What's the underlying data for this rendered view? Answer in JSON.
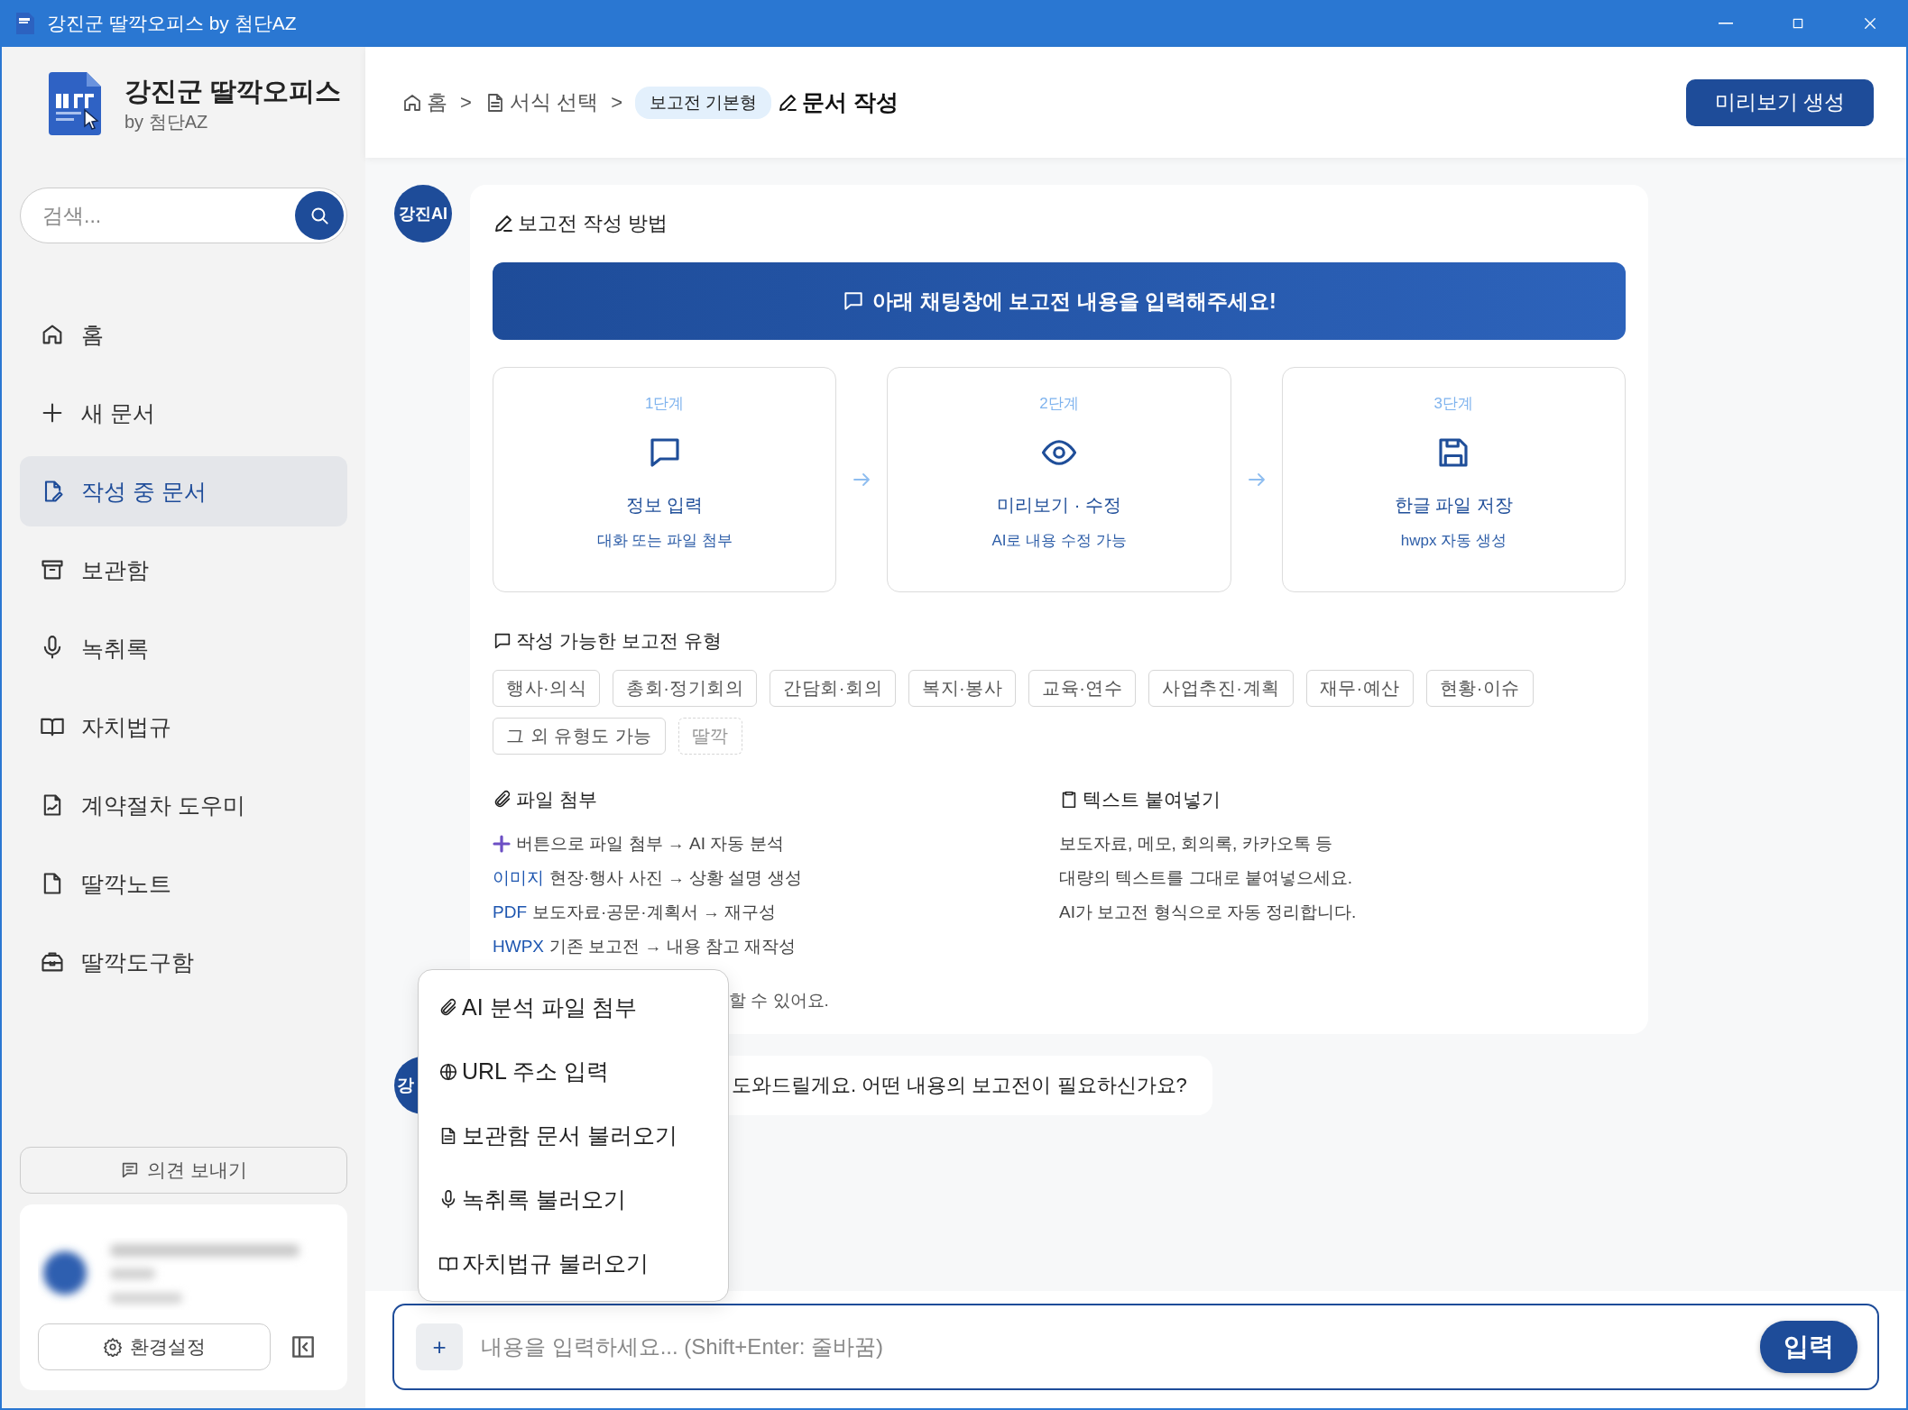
{
  "window": {
    "title": "강진군 딸깍오피스 by 첨단AZ"
  },
  "sidebar": {
    "app_name": "강진군 딸깍오피스",
    "byline": "by 첨단AZ",
    "search": {
      "placeholder": "검색..."
    },
    "items": [
      {
        "label": "홈",
        "kind": "home",
        "selected": false
      },
      {
        "label": "새 문서",
        "kind": "plus",
        "selected": false
      },
      {
        "label": "작성 중 문서",
        "kind": "doc-edit",
        "selected": true
      },
      {
        "label": "보관함",
        "kind": "archive",
        "selected": false
      },
      {
        "label": "녹취록",
        "kind": "mic",
        "selected": false
      },
      {
        "label": "자치법규",
        "kind": "book",
        "selected": false
      },
      {
        "label": "계약절차 도우미",
        "kind": "contract",
        "selected": false
      },
      {
        "label": "딸깍노트",
        "kind": "note",
        "selected": false
      },
      {
        "label": "딸깍도구함",
        "kind": "toolbox",
        "selected": false
      }
    ],
    "feedback_button": "의견 보내기",
    "settings_button": "환경설정"
  },
  "header": {
    "breadcrumb": [
      {
        "label": "홈",
        "kind": "home"
      },
      {
        "label": "서식 선택",
        "kind": "doc"
      },
      {
        "label": "보고전 기본형",
        "kind": "tag"
      },
      {
        "label": "문서 작성",
        "kind": "current"
      }
    ],
    "separators": [
      ">",
      ">"
    ],
    "preview_button": "미리보기 생성"
  },
  "guide": {
    "avatar": "강진AI",
    "title": "보고전 작성 방법",
    "banner": "아래 채팅창에 보고전 내용을 입력해주세요!",
    "steps": [
      {
        "step": "1단계",
        "kind": "chat",
        "title": "정보 입력",
        "desc": "대화 또는 파일 첨부"
      },
      {
        "step": "2단계",
        "kind": "eye",
        "title": "미리보기 · 수정",
        "desc": "AI로 내용 수정 가능"
      },
      {
        "step": "3단계",
        "kind": "save",
        "title": "한글 파일 저장",
        "desc": "hwpx 자동 생성"
      }
    ],
    "types_title": "작성 가능한 보고전 유형",
    "types": [
      {
        "label": "행사·의식",
        "kind": "solid"
      },
      {
        "label": "총회·정기회의",
        "kind": "solid"
      },
      {
        "label": "간담회·회의",
        "kind": "solid"
      },
      {
        "label": "복지·봉사",
        "kind": "solid"
      },
      {
        "label": "교육·연수",
        "kind": "solid"
      },
      {
        "label": "사업추진·계획",
        "kind": "solid"
      },
      {
        "label": "재무·예산",
        "kind": "solid"
      },
      {
        "label": "현황·이슈",
        "kind": "solid"
      },
      {
        "label": "그 외 유형도 가능",
        "kind": "solid"
      },
      {
        "label": "딸깍",
        "kind": "dashed"
      }
    ],
    "attach_title": "파일 첨부",
    "attach_lines": [
      {
        "kind": "plus",
        "text": "버튼으로 파일 첨부 → AI 자동 분석"
      },
      {
        "kind": "label",
        "label": "이미지",
        "text": "현장·행사 사진 → 상황 설명 생성"
      },
      {
        "kind": "label",
        "label": "PDF",
        "text": "보도자료·공문·계획서 → 재구성"
      },
      {
        "kind": "label",
        "label": "HWPX",
        "text": "기존 보고전 → 내용 참고 재작성"
      }
    ],
    "paste_title": "텍스트 붙여넣기",
    "paste_lines": [
      "보도자료, 메모, 회의록, 카카오톡 등",
      "대량의 텍스트를 그대로 붙여넣으세요.",
      "AI가 보고전 형식으로 자동 정리합니다."
    ],
    "note": "할 수 있어요."
  },
  "message": {
    "avatar": "강",
    "text": "도와드릴게요. 어떤 내용의 보고전이 필요하신가요?"
  },
  "attach_menu": [
    {
      "label": "AI 분석 파일 첨부",
      "kind": "clip"
    },
    {
      "label": "URL 주소 입력",
      "kind": "globe"
    },
    {
      "label": "보관함 문서 불러오기",
      "kind": "doc"
    },
    {
      "label": "녹취록 불러오기",
      "kind": "mic"
    },
    {
      "label": "자치법규 불러오기",
      "kind": "book"
    }
  ],
  "composer": {
    "plus": "+",
    "placeholder": "내용을 입력하세요... (Shift+Enter: 줄바꿈)",
    "submit": "입력"
  }
}
